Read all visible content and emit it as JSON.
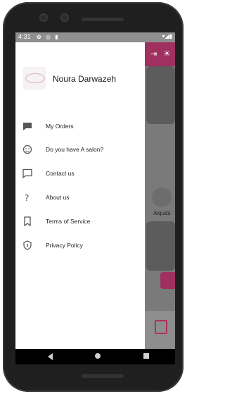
{
  "status_bar": {
    "time": "4:31",
    "left_icons": "✿ ◎ ▮",
    "right_icons": "▾◢▮"
  },
  "drawer": {
    "user_name": "Noura Darwazeh",
    "items": [
      {
        "label": "My Orders",
        "icon": "orders-icon"
      },
      {
        "label": "Do you have A salon?",
        "icon": "salon-icon"
      },
      {
        "label": "Contact us",
        "icon": "chat-icon"
      },
      {
        "label": "About us",
        "icon": "help-icon"
      },
      {
        "label": "Terms of Service",
        "icon": "bookmark-icon"
      },
      {
        "label": "Privacy Policy",
        "icon": "shield-icon"
      }
    ]
  },
  "background_app": {
    "location_label": "Alquds"
  },
  "colors": {
    "accent": "#a03060"
  }
}
